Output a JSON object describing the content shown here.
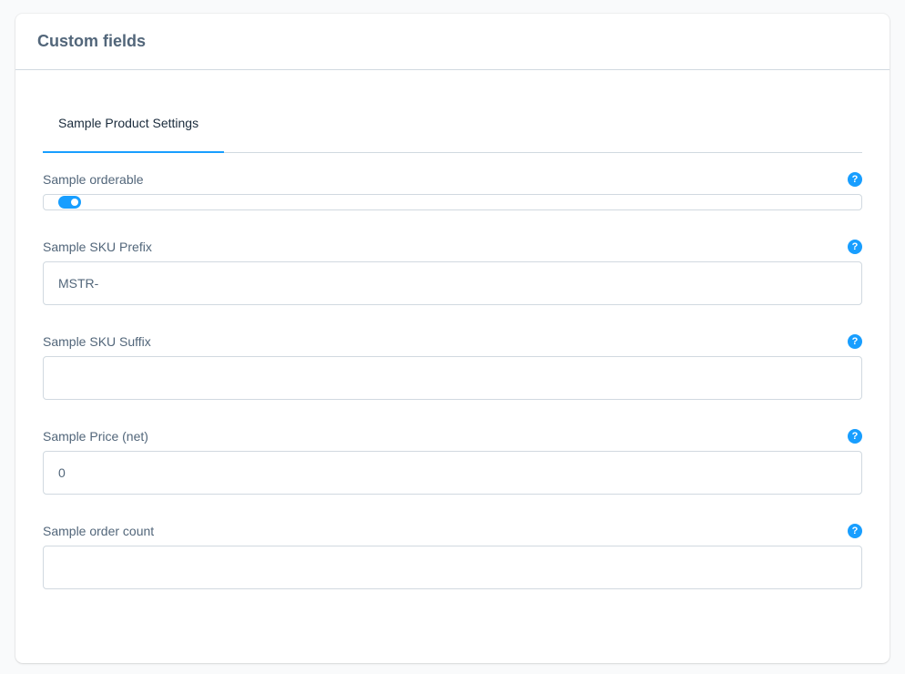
{
  "card": {
    "title": "Custom fields"
  },
  "tabs": [
    {
      "label": "Sample Product Settings",
      "active": true
    }
  ],
  "fields": {
    "sample_orderable": {
      "label": "Sample orderable",
      "checked": true
    },
    "sample_sku_prefix": {
      "label": "Sample SKU Prefix",
      "value": "MSTR-"
    },
    "sample_sku_suffix": {
      "label": "Sample SKU Suffix",
      "value": ""
    },
    "sample_price_net": {
      "label": "Sample Price (net)",
      "value": "0"
    },
    "sample_order_count": {
      "label": "Sample order count",
      "value": ""
    }
  },
  "help_icon_glyph": "?",
  "colors": {
    "accent": "#189eff",
    "border": "#d1d9e0",
    "text": "#52667a"
  }
}
